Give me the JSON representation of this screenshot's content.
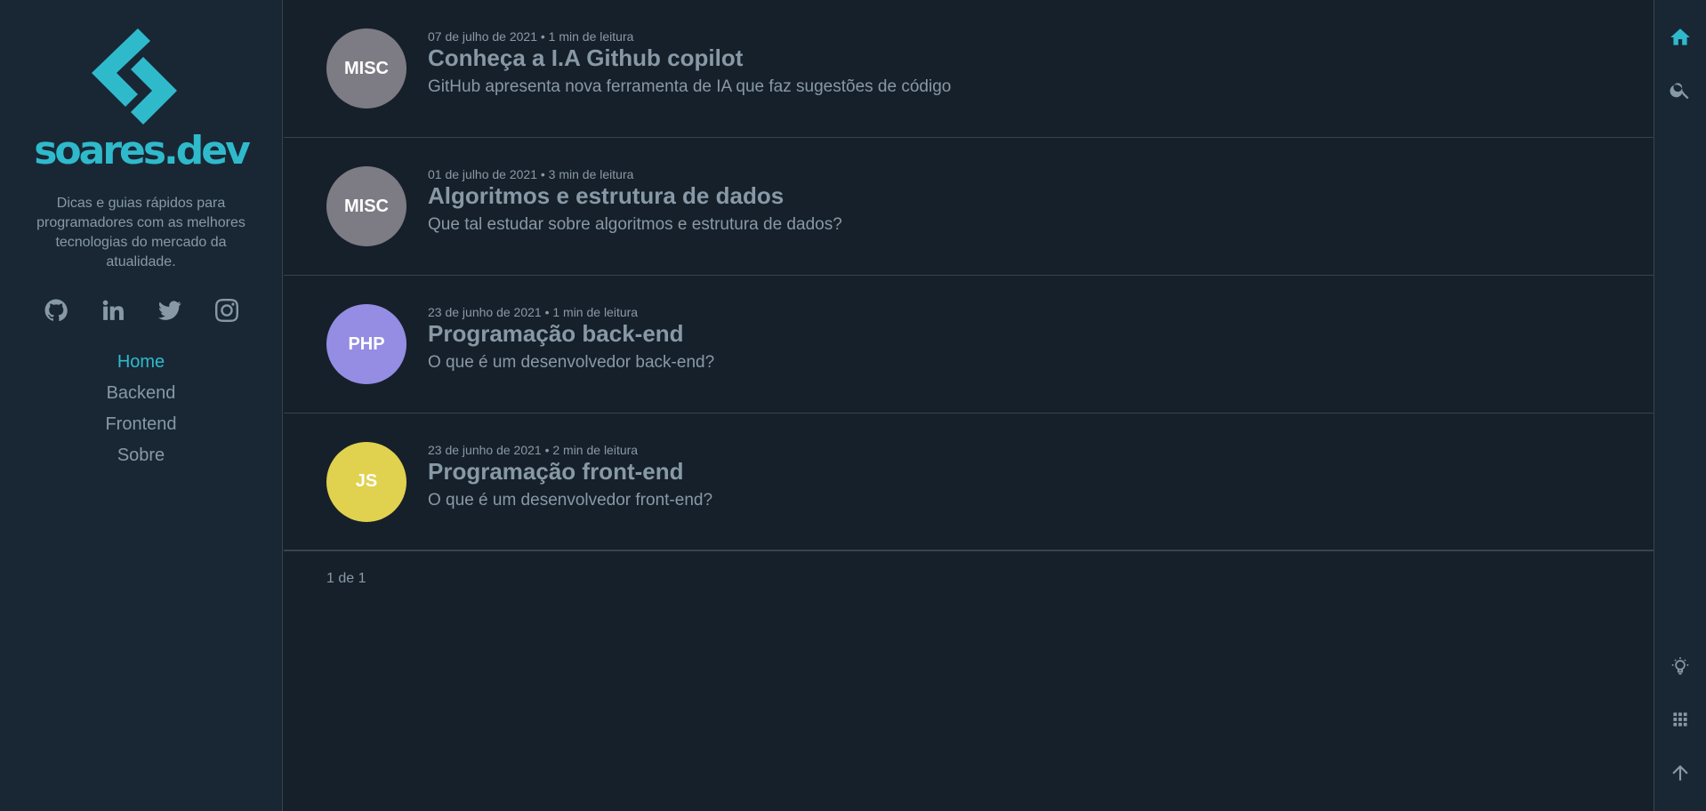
{
  "sidebar": {
    "logo_text": "soares.dev",
    "tagline": "Dicas e guias rápidos para programadores com as melhores tecnologias do mercado da atualidade.",
    "social": [
      "github-icon",
      "linkedin-icon",
      "twitter-icon",
      "instagram-icon"
    ],
    "nav": [
      {
        "label": "Home",
        "active": true
      },
      {
        "label": "Backend",
        "active": false
      },
      {
        "label": "Frontend",
        "active": false
      },
      {
        "label": "Sobre",
        "active": false
      }
    ]
  },
  "posts": [
    {
      "tag": "MISC",
      "tag_color": "#7d7b84",
      "meta": "07 de julho de 2021 • 1 min de leitura",
      "title": "Conheça a I.A Github copilot",
      "description": "GitHub apresenta nova ferramenta de IA que faz sugestões de código"
    },
    {
      "tag": "MISC",
      "tag_color": "#7d7b84",
      "meta": "01 de julho de 2021 • 3 min de leitura",
      "title": "Algoritmos e estrutura de dados",
      "description": "Que tal estudar sobre algoritmos e estrutura de dados?"
    },
    {
      "tag": "PHP",
      "tag_color": "#948de3",
      "meta": "23 de junho de 2021 • 1 min de leitura",
      "title": "Programação back-end",
      "description": "O que é um desenvolvedor back-end?"
    },
    {
      "tag": "JS",
      "tag_color": "#e0d14f",
      "meta": "23 de junho de 2021 • 2 min de leitura",
      "title": "Programação front-end",
      "description": "O que é um desenvolvedor front-end?"
    }
  ],
  "pagination": "1 de 1",
  "rightbar": [
    "home-icon",
    "search-icon",
    "lightbulb-icon",
    "grid-icon",
    "arrow-up-icon"
  ],
  "colors": {
    "accent": "#2fbacc",
    "background": "#16202a",
    "sidebar": "#192734",
    "text": "#8899a6",
    "border": "#38444d"
  }
}
